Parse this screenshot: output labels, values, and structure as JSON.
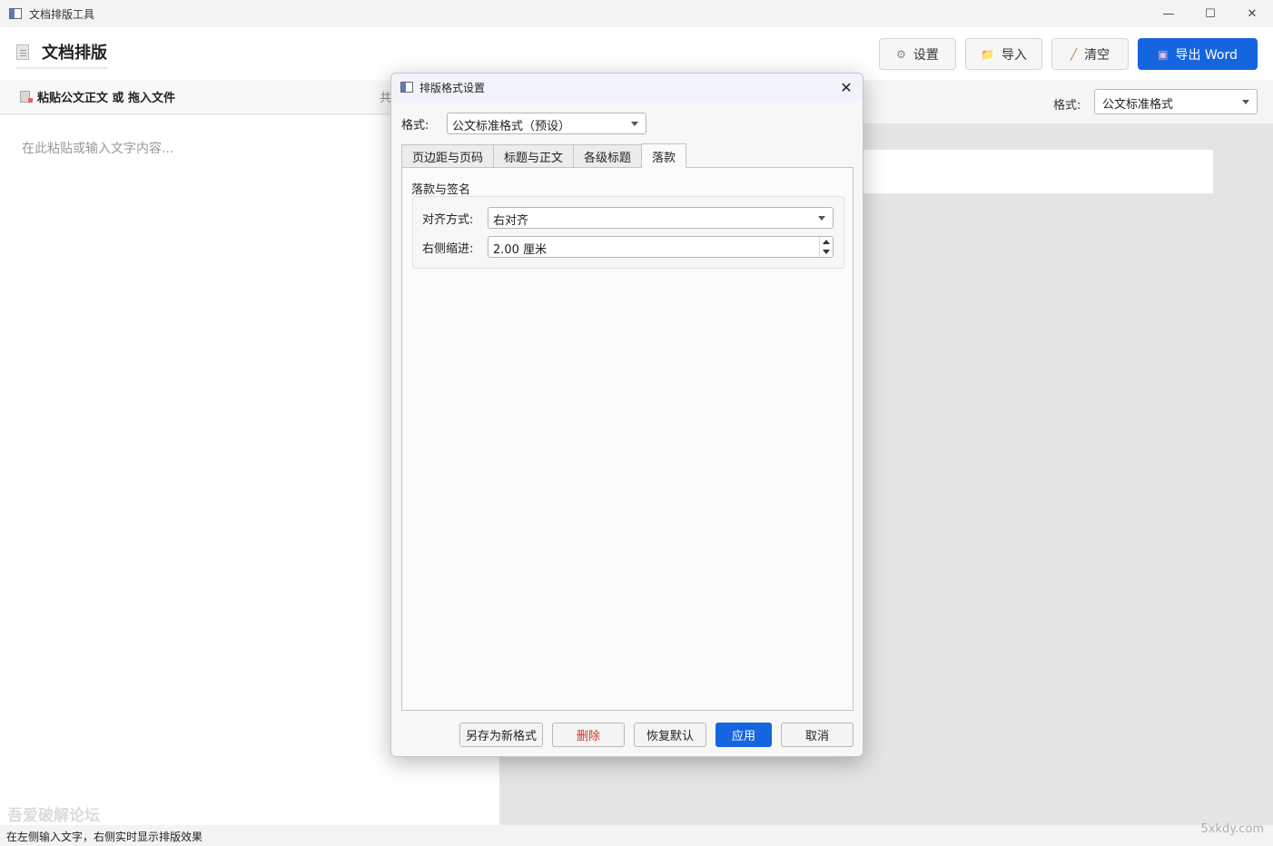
{
  "window": {
    "title": "文档排版工具",
    "controls": {
      "minimize": "—",
      "maximize": "☐",
      "close": "✕"
    }
  },
  "header": {
    "app_title": "文档排版",
    "buttons": {
      "settings": {
        "label": "设置",
        "icon": "⚙"
      },
      "import": {
        "label": "导入",
        "icon": "📁"
      },
      "clear": {
        "label": "清空",
        "icon": "╱"
      },
      "export": {
        "label": "导出 Word",
        "icon": "▣"
      }
    }
  },
  "left_panel": {
    "title": "粘贴公文正文 或 拖入文件",
    "count_prefix": "共",
    "placeholder": "在此粘贴或输入文字内容..."
  },
  "right_panel": {
    "format_label": "格式:",
    "format_value": "公文标准格式"
  },
  "status_bar": {
    "text": "在左侧输入文字，右侧实时显示排版效果"
  },
  "watermarks": {
    "left": "吾爱破解论坛",
    "right": "5xkdy.com"
  },
  "dialog": {
    "title": "排版格式设置",
    "format_label": "格式:",
    "format_value": "公文标准格式（预设）",
    "tabs": [
      "页边距与页码",
      "标题与正文",
      "各级标题",
      "落款"
    ],
    "active_tab": "落款",
    "group_title": "落款与签名",
    "align_label": "对齐方式:",
    "align_value": "右对齐",
    "indent_label": "右侧缩进:",
    "indent_value": "2.00 厘米",
    "buttons": {
      "save_as": "另存为新格式",
      "delete": "删除",
      "restore": "恢复默认",
      "apply": "应用",
      "cancel": "取消"
    },
    "colors": {
      "primary": "#1565e0",
      "danger": "#d03030"
    }
  }
}
